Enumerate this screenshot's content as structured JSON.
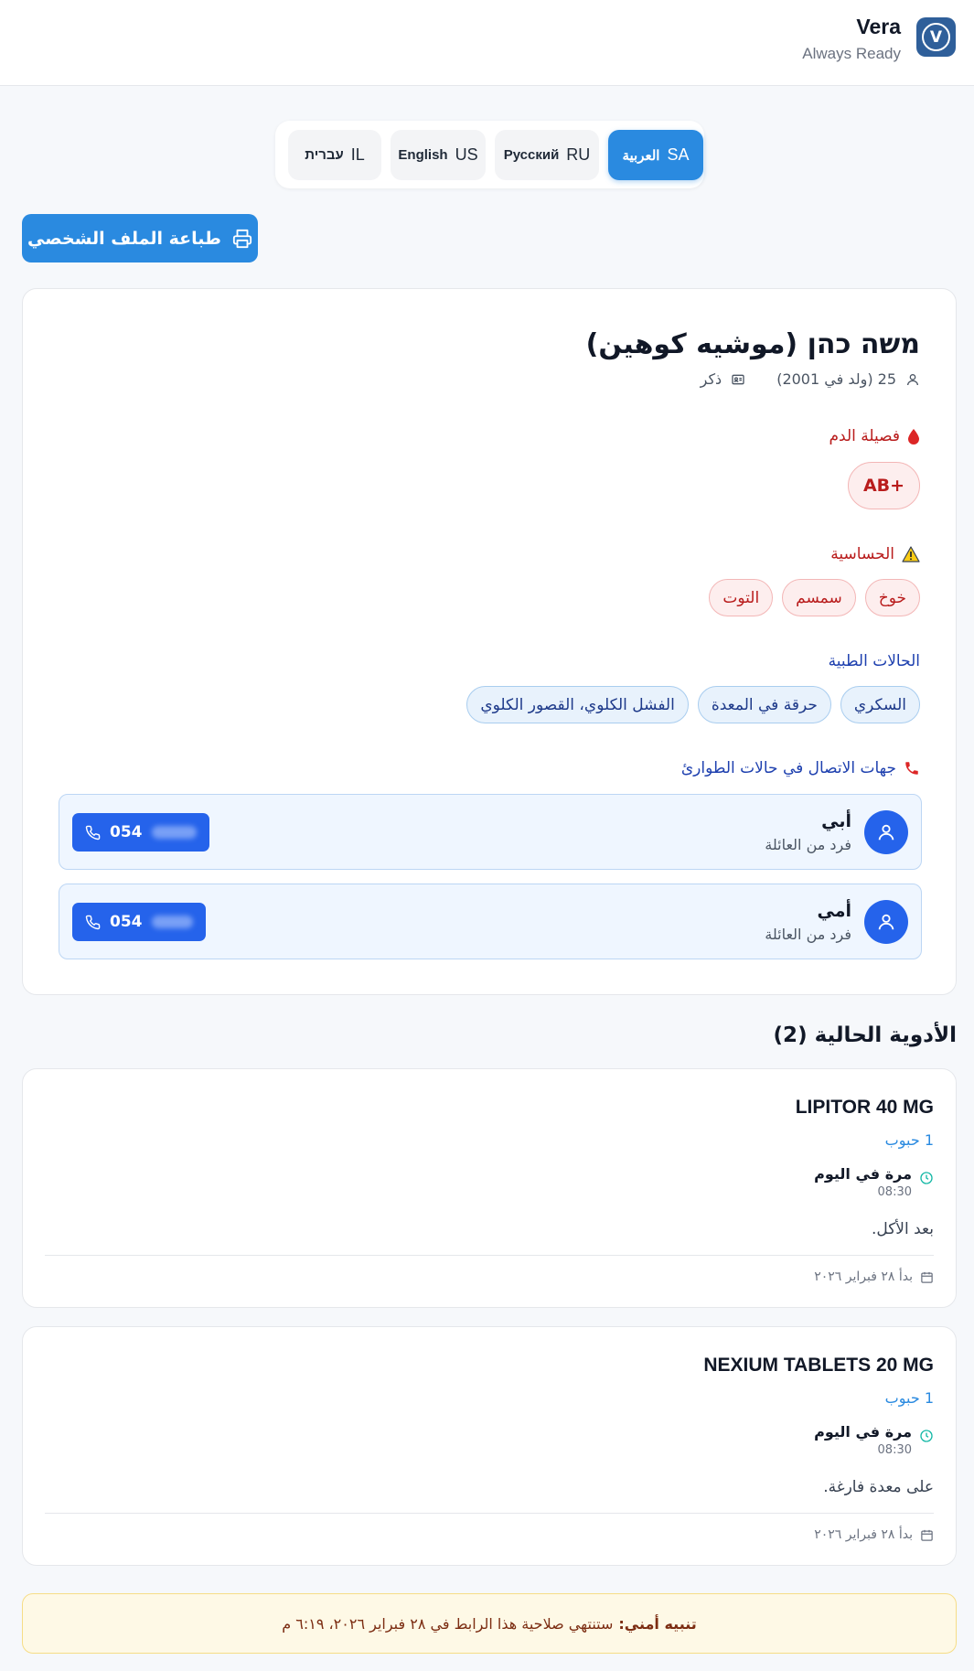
{
  "header": {
    "brand_name": "Vera",
    "brand_tagline": "Always Ready",
    "logo_letter": "V"
  },
  "languages": [
    {
      "code": "SA",
      "label": "العربية",
      "active": true
    },
    {
      "code": "RU",
      "label": "Русский",
      "active": false
    },
    {
      "code": "US",
      "label": "English",
      "active": false
    },
    {
      "code": "IL",
      "label": "עברית",
      "active": false
    }
  ],
  "print_button_label": "طباعة الملف الشخصي",
  "profile": {
    "name": "משה כהן (موشيه كوهين)",
    "age_text": "25 (ولد في 2001)",
    "gender": "ذكر",
    "blood_type_label": "فصيلة الدم",
    "blood_type": "AB+",
    "allergies_label": "الحساسية",
    "allergies": [
      "خوخ",
      "سمسم",
      "التوت"
    ],
    "conditions_label": "الحالات الطبية",
    "conditions": [
      "السكري",
      "حرقة في المعدة",
      "الفشل الكلوي، القصور الكلوي"
    ],
    "emergency_label": "جهات الاتصال في حالات الطوارئ",
    "contacts": [
      {
        "name": "أبي",
        "relation": "فرد من العائلة",
        "phone_prefix": "054"
      },
      {
        "name": "أمي",
        "relation": "فرد من العائلة",
        "phone_prefix": "054"
      }
    ]
  },
  "medications": {
    "title": "الأدوية الحالية (2)",
    "items": [
      {
        "name": "LIPITOR 40 MG",
        "dose": "1 حبوب",
        "frequency": "مرة في اليوم",
        "time": "08:30",
        "note": "بعد الأكل.",
        "start": "بدأ ٢٨ فبراير ٢٠٢٦"
      },
      {
        "name": "NEXIUM TABLETS 20 MG",
        "dose": "1 حبوب",
        "frequency": "مرة في اليوم",
        "time": "08:30",
        "note": "على معدة فارغة.",
        "start": "بدأ ٢٨ فبراير ٢٠٢٦"
      }
    ]
  },
  "notice": {
    "title": "تنبيه أمني:",
    "text": "ستنتهي صلاحية هذا الرابط في ٢٨ فبراير ٢٠٢٦، ٦:١٩ م"
  },
  "colors": {
    "primary": "#2a8ae0",
    "contact_button": "#2563eb",
    "alert_red": "#b91c1c",
    "notice_bg": "#fef9e6"
  }
}
